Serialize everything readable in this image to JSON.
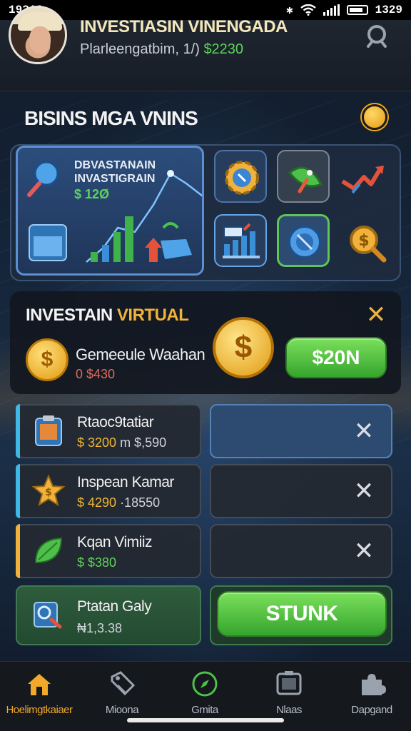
{
  "status_bar": {
    "time_left": "19318",
    "time_right": "1329"
  },
  "header": {
    "title": "INVESTIASIN VINENGADA",
    "subtitle_text": "Plarleengatbim, 1/)",
    "subtitle_amount": "$2230"
  },
  "section": {
    "title": "BISINS MGA VNINS"
  },
  "dashboard": {
    "label": "DBVASTANAIN\nINVASTIGRAIN",
    "amount": "$ 12Ø",
    "tile_icons": [
      "gear-icon",
      "rocket-icon",
      "arrow-chart-icon",
      "bar-chart-icon",
      "globe-icon",
      "magnifier-coin-icon"
    ]
  },
  "investain_panel": {
    "title_main": "INVESTAIN ",
    "title_accent": "VIRTUAL",
    "item_name": "Gemeeule Waahan",
    "item_value": "0 $430",
    "button_label": "$20N"
  },
  "rows": [
    {
      "name": "Rtaoc9tatiar",
      "value_gold": "$ 3200",
      "value_rest": " m $,590",
      "bar_color": "#3fb8e6",
      "icon": "calculator-icon"
    },
    {
      "name": "Inspean Kamar",
      "value_gold": "$ 4290",
      "value_rest": " ·18550",
      "bar_color": "#3fb8e6",
      "icon": "star-coin-icon"
    },
    {
      "name": "Kqan Vimiiz",
      "value_green": "$ $380",
      "bar_color": "#f0b23a",
      "icon": "leaf-icon"
    },
    {
      "name": "Ptatan Galy",
      "value_plain": "₦1,3.38",
      "icon": "search-doc-icon"
    }
  ],
  "stunk_button": "STUNK",
  "nav": [
    {
      "label": "Hoelimgtkaiaer",
      "icon": "home-icon"
    },
    {
      "label": "Mioona",
      "icon": "tag-icon"
    },
    {
      "label": "Gmita",
      "icon": "compass-icon"
    },
    {
      "label": "Nlaas",
      "icon": "screen-icon"
    },
    {
      "label": "Dapgand",
      "icon": "puzzle-icon"
    }
  ],
  "colors": {
    "accent_gold": "#f0b23a",
    "accent_green": "#5ed35a",
    "panel_blue": "#2d4b70"
  }
}
